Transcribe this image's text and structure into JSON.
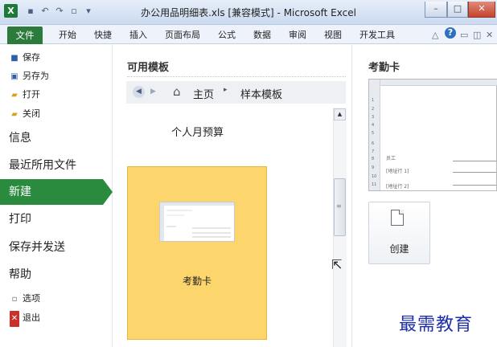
{
  "window": {
    "title": "办公用品明细表.xls [兼容模式] - Microsoft Excel",
    "controls": {
      "minimize": "–",
      "maximize": "□",
      "close": "✕"
    }
  },
  "ribbon": {
    "tabs": [
      "文件",
      "开始",
      "快捷",
      "插入",
      "页面布局",
      "公式",
      "数据",
      "审阅",
      "视图",
      "开发工具"
    ],
    "help_glyph": "?"
  },
  "backstage_nav": {
    "save": "保存",
    "save_as": "另存为",
    "open": "打开",
    "close": "关闭",
    "info": "信息",
    "recent": "最近所用文件",
    "new": "新建",
    "print": "打印",
    "save_send": "保存并发送",
    "help": "帮助",
    "options": "选项",
    "exit": "退出",
    "selected": "新建"
  },
  "templates": {
    "heading": "可用模板",
    "breadcrumb": {
      "home": "主页",
      "separator": "▸",
      "current": "样本模板"
    },
    "items": [
      {
        "label": "个人月预算",
        "selected": false
      },
      {
        "label": "考勤卡",
        "selected": true
      }
    ]
  },
  "preview": {
    "heading": "考勤卡",
    "thumbnail_text": {
      "employee": "员工",
      "row9": "[地址行 1]",
      "row11": "[地址行 2]"
    },
    "row_numbers": [
      "1",
      "2",
      "3",
      "4",
      "5",
      "6",
      "7",
      "8",
      "9",
      "10",
      "11"
    ]
  },
  "actions": {
    "create_label": "创建"
  },
  "watermark": "最需教育",
  "colors": {
    "file_tab": "#2c7a3c",
    "selected_nav": "#2a8a3e",
    "selected_template": "#fcd56c"
  }
}
